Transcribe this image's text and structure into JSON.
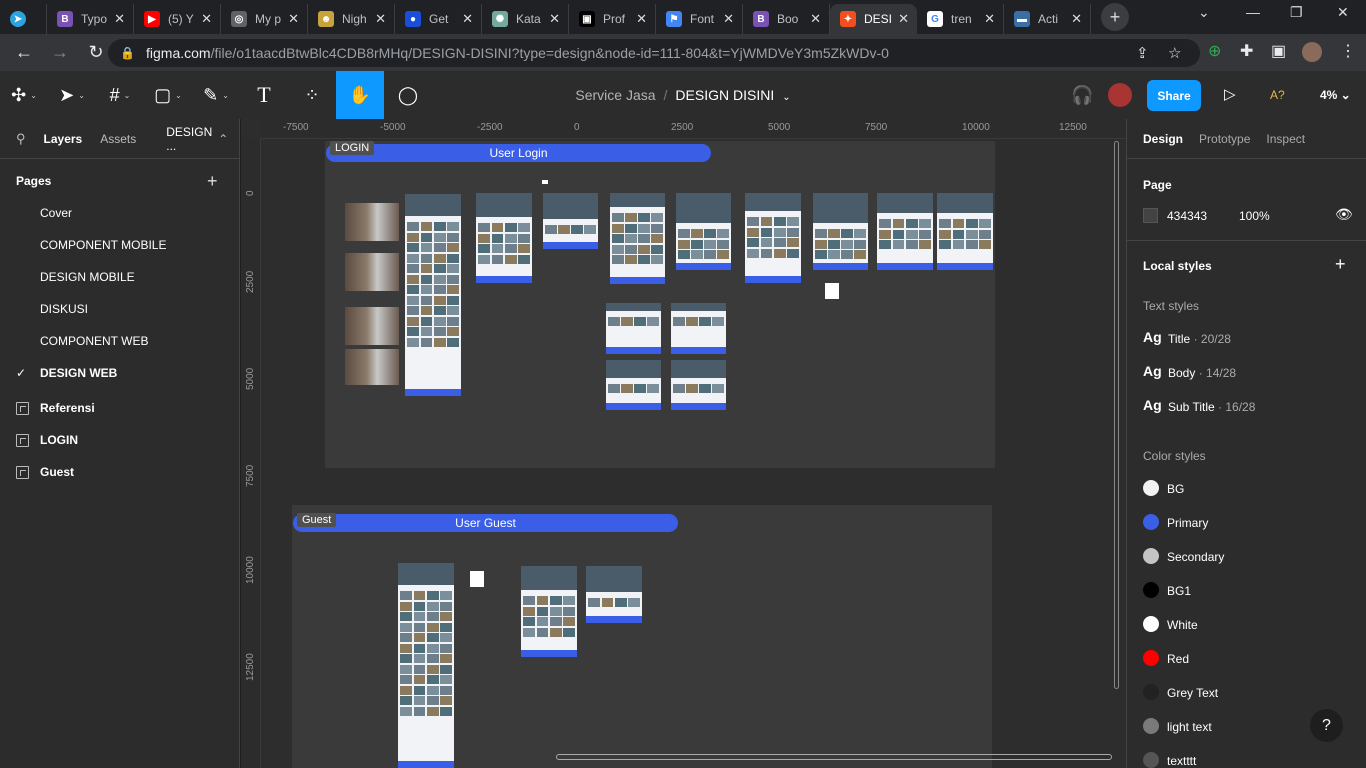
{
  "browser": {
    "tabs": [
      {
        "title": "Typo",
        "fav_color": "#7952b3",
        "fav_text": "B"
      },
      {
        "title": "(5) Y",
        "fav_color": "#ff0000",
        "fav_text": "▶"
      },
      {
        "title": "My p",
        "fav_color": "#5f6368",
        "fav_text": "◎"
      },
      {
        "title": "Nigh",
        "fav_color": "#c7a33b",
        "fav_text": "☻"
      },
      {
        "title": "Get",
        "fav_color": "#1a4ed8",
        "fav_text": "●"
      },
      {
        "title": "Kata",
        "fav_color": "#74aa9c",
        "fav_text": "✺"
      },
      {
        "title": "Prof",
        "fav_color": "#000000",
        "fav_text": "▣"
      },
      {
        "title": "Font",
        "fav_color": "#4285f4",
        "fav_text": "⚑"
      },
      {
        "title": "Boo",
        "fav_color": "#7952b3",
        "fav_text": "B"
      },
      {
        "title": "DESI",
        "fav_color": "#f24e1e",
        "fav_text": "✦",
        "active": true
      },
      {
        "title": "tren",
        "fav_color": "#ffffff",
        "fav_text": "G"
      },
      {
        "title": "Acti",
        "fav_color": "#3a6ea5",
        "fav_text": "▬"
      }
    ],
    "first_tab_icon": "telegram-icon",
    "url_host": "figma.com",
    "url_rest": "/file/o1taacdBtwBlc4CDB8rMHq/DESIGN-DISINI?type=design&node-id=111-804&t=YjWMDVeY3m5ZkWDv-0"
  },
  "figma": {
    "project": "Service Jasa",
    "separator": "/",
    "file": "DESIGN DISINI",
    "share_label": "Share",
    "a11y_label": "A?",
    "zoom": "4%"
  },
  "left": {
    "tab_layers": "Layers",
    "tab_assets": "Assets",
    "tab_page": "DESIGN ...",
    "pages_header": "Pages",
    "pages": [
      {
        "label": "Cover",
        "type": "page"
      },
      {
        "label": "COMPONENT MOBILE",
        "type": "page"
      },
      {
        "label": "DESIGN MOBILE",
        "type": "page"
      },
      {
        "label": "DISKUSI",
        "type": "page"
      },
      {
        "label": "COMPONENT WEB",
        "type": "page"
      },
      {
        "label": "DESIGN WEB",
        "type": "page",
        "current": true
      },
      {
        "label": "Referensi",
        "type": "frame"
      },
      {
        "label": "LOGIN",
        "type": "frame"
      },
      {
        "label": "Guest",
        "type": "frame"
      }
    ]
  },
  "canvas": {
    "ruler_x": [
      "-7500",
      "-5000",
      "-2500",
      "0",
      "2500",
      "5000",
      "7500",
      "10000",
      "12500"
    ],
    "ruler_y": [
      "0",
      "2500",
      "5000",
      "7500",
      "10000",
      "12500"
    ],
    "section_login": {
      "tag": "LOGIN",
      "title": "User Login"
    },
    "section_guest": {
      "tag": "Guest",
      "title": "User Guest"
    }
  },
  "right": {
    "tab_design": "Design",
    "tab_prototype": "Prototype",
    "tab_inspect": "Inspect",
    "page_header": "Page",
    "page_color": "434343",
    "page_opacity": "100%",
    "local_styles": "Local styles",
    "text_styles_header": "Text styles",
    "text_styles": [
      {
        "ag": "Ag",
        "name": "Title",
        "meta": " · 20/28"
      },
      {
        "ag": "Ag",
        "name": "Body",
        "meta": " · 14/28"
      },
      {
        "ag": "Ag",
        "name": "Sub Title",
        "meta": " · 16/28"
      }
    ],
    "color_styles_header": "Color styles",
    "color_styles": [
      {
        "name": "BG",
        "color": "#f2f2f2"
      },
      {
        "name": "Primary",
        "color": "#3b5ee6"
      },
      {
        "name": "Secondary",
        "color": "#c4c4c4"
      },
      {
        "name": "BG1",
        "color": "#000000"
      },
      {
        "name": "White",
        "color": "#ffffff"
      },
      {
        "name": "Red",
        "color": "#ff0000"
      },
      {
        "name": "Grey Text",
        "color": "#222222"
      },
      {
        "name": "light text",
        "color": "#7a7a7a"
      },
      {
        "name": "textttt",
        "color": "#555555"
      }
    ],
    "help_label": "?"
  }
}
